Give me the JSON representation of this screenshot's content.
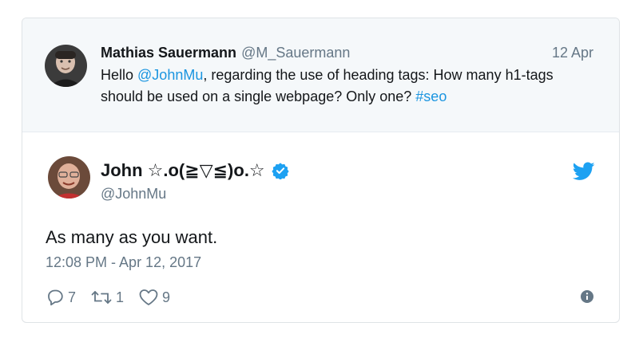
{
  "parent_tweet": {
    "name": "Mathias Sauermann",
    "handle": "@M_Sauermann",
    "date": "12 Apr",
    "text_parts": {
      "prefix": "Hello ",
      "mention": "@JohnMu",
      "middle": ", regarding the use of heading tags: How many h1-tags should be used on a single webpage? Only one? ",
      "hashtag": "#seo"
    }
  },
  "main_tweet": {
    "name": "John ☆.o(≧▽≦)o.☆",
    "handle": "@JohnMu",
    "verified": true,
    "text": "As many as you want.",
    "timestamp": "12:08 PM - Apr 12, 2017",
    "actions": {
      "replies": "7",
      "retweets": "1",
      "likes": "9"
    }
  },
  "colors": {
    "link": "#1b95e0",
    "muted": "#657786",
    "header_bg": "#f5f8fa",
    "brand": "#1da1f2"
  },
  "icons": [
    "reply-icon",
    "retweet-icon",
    "like-icon",
    "info-icon",
    "twitter-bird-icon",
    "verified-badge-icon"
  ]
}
